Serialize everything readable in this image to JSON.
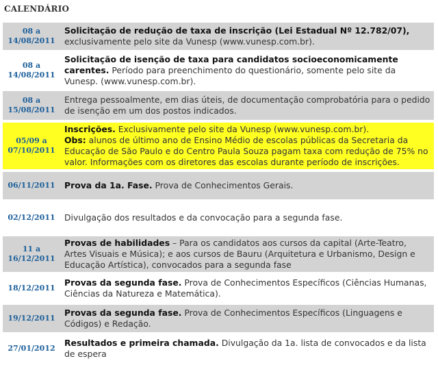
{
  "heading": "CALENDÁRIO",
  "rows": [
    {
      "style": "gray",
      "date_lines": [
        "08 a",
        "14/08/2011"
      ],
      "title": "Solicitação de redução de taxa de inscrição (Lei Estadual Nº 12.782/07),",
      "body": "exclusivamente pelo site da Vunesp (",
      "link": "www.vunesp.com.br",
      "body_after": ")."
    },
    {
      "style": "white",
      "date_lines": [
        "08 a",
        "14/08/2011"
      ],
      "title": "Solicitação de isenção de taxa para candidatos socioeconomicamente carentes.",
      "body": " Período para preenchimento do questionário, somente pelo site da Vunesp. (",
      "link": "www.vunesp.com.br",
      "body_after": ")."
    },
    {
      "style": "gray",
      "date_lines": [
        "08 a",
        "15/08/2011"
      ],
      "title": "",
      "body": "Entrega pessoalmente, em dias úteis, de documentação comprobatória para o pedido de isenção em um dos postos indicados.",
      "link": "",
      "body_after": ""
    },
    {
      "style": "yellow",
      "date_lines": [
        "05/09 a",
        "07/10/2011"
      ],
      "title": "Inscrições.",
      "body": " Exclusivamente pelo site da Vunesp (",
      "link": "www.vunesp.com.br",
      "body_after": ").",
      "obs_label": "Obs:",
      "obs_text": " alunos de último ano de Ensino Médio de escolas públicas da Secretaria da Educação de São Paulo e do Centro Paula Souza pagam taxa com redução de 75% no valor. Informações com os diretores das escolas durante período de inscrições."
    },
    {
      "style": "gray",
      "date_lines": [
        "06/11/2011"
      ],
      "title": "Prova da 1a. Fase.",
      "body": " Prova de Conhecimentos Gerais.",
      "link": "",
      "body_after": ""
    },
    {
      "style": "white",
      "date_lines": [
        "02/12/2011"
      ],
      "title": "",
      "body": "Divulgação dos resultados e da convocação para a segunda fase.",
      "link": "",
      "body_after": ""
    },
    {
      "style": "gray",
      "date_lines": [
        "11 a",
        "16/12/2011"
      ],
      "title": "Provas de habilidades",
      "body": " – Para os candidatos aos cursos da capital (Arte-Teatro, Artes Visuais e Música); e aos cursos de Bauru (Arquitetura e Urbanismo, Design e Educação Artística), convocados para a segunda fase",
      "link": "",
      "body_after": ""
    },
    {
      "style": "white",
      "date_lines": [
        "18/12/2011"
      ],
      "title": "Provas da segunda fase.",
      "body": " Prova de Conhecimentos Específicos (Ciências Humanas, Ciências da Natureza e Matemática).",
      "link": "",
      "body_after": ""
    },
    {
      "style": "gray",
      "date_lines": [
        "19/12/2011"
      ],
      "title": "Provas da segunda fase.",
      "body": " Prova de Conhecimentos Específicos (Linguagens e Códigos) e Redação.",
      "link": "",
      "body_after": ""
    },
    {
      "style": "white",
      "date_lines": [
        "27/01/2012"
      ],
      "title": "Resultados e primeira chamada.",
      "body": " Divulgação da 1a. lista de convocados e da lista de espera",
      "link": "",
      "body_after": ""
    }
  ]
}
